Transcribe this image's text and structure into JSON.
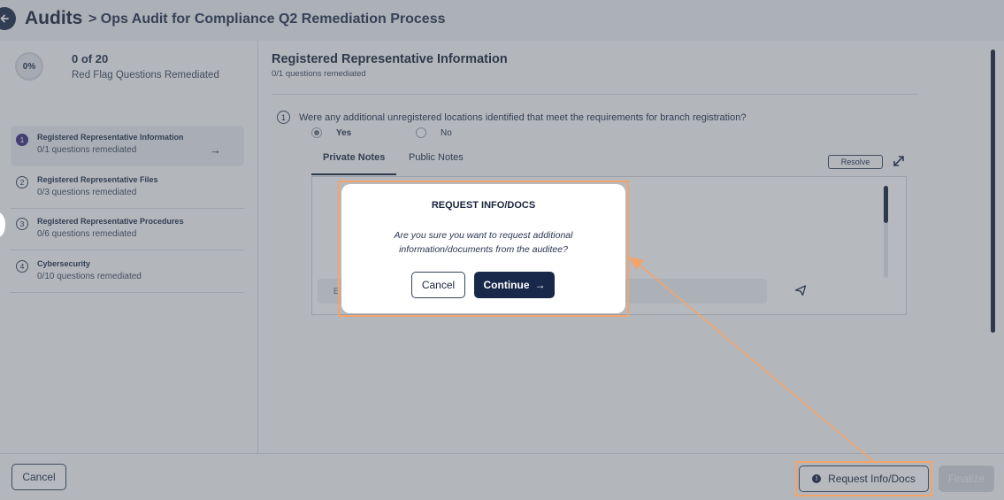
{
  "header": {
    "title": "Audits",
    "breadcrumb": "> Ops Audit for Compliance Q2 Remediation Process"
  },
  "progress": {
    "percent_label": "0%",
    "count_current": "0",
    "count_of": "of 20",
    "label": "Red Flag Questions Remediated"
  },
  "sections": [
    {
      "number": "1",
      "title": "Registered Representative Information",
      "subtitle": "0/1 questions remediated",
      "active": true
    },
    {
      "number": "2",
      "title": "Registered Representative Files",
      "subtitle": "0/3 questions remediated"
    },
    {
      "number": "3",
      "title": "Registered Representative Procedures",
      "subtitle": "0/6 questions remediated"
    },
    {
      "number": "4",
      "title": "Cybersecurity",
      "subtitle": "0/10 questions remediated"
    }
  ],
  "main": {
    "title": "Registered Representative Information",
    "subtitle": "0/1 questions remediated",
    "question": {
      "number": "1",
      "text": "Were any additional unregistered locations identified that meet the requirements for branch registration?",
      "options": [
        "Yes",
        "No"
      ],
      "selected": "Yes"
    },
    "tabs": [
      "Private Notes",
      "Public Notes"
    ],
    "resolve_label": "Resolve",
    "note_input_placeholder": "E"
  },
  "modal": {
    "title": "REQUEST INFO/DOCS",
    "body": "Are you sure you want to request additional information/documents from the auditee?",
    "cancel_label": "Cancel",
    "continue_label": "Continue"
  },
  "footer": {
    "cancel_label": "Cancel",
    "request_label": "Request Info/Docs",
    "finalize_label": "Finalize"
  },
  "colors": {
    "primary": "#17284a",
    "highlight": "#f2a46b",
    "active_badge": "#3d2b7a"
  }
}
